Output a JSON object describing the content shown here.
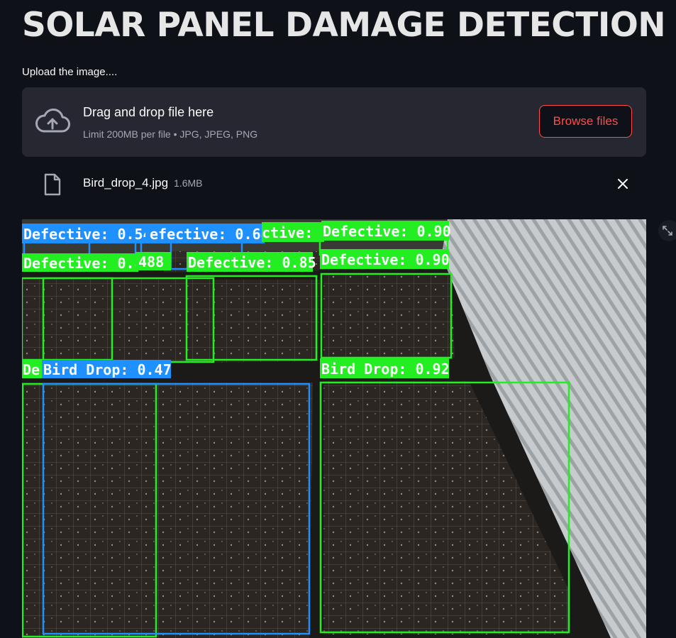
{
  "page": {
    "title": "SOLAR PANEL DAMAGE DETECTION",
    "upload_label": "Upload the image...."
  },
  "uploader": {
    "dropzone_title": "Drag and drop file here",
    "limit_text": "Limit 200MB per file • JPG, JPEG, PNG",
    "browse_label": "Browse files",
    "icon": "cloud-upload-icon"
  },
  "uploaded_file": {
    "name": "Bird_drop_4.jpg",
    "size": "1.6MB",
    "icon": "file-icon",
    "remove_icon": "close-icon"
  },
  "result_image": {
    "labels": {
      "l1": "Defective: 0.54",
      "l2": "efective: 0.68",
      "l3": "ctive: (",
      "l4": "Defective: 0.90",
      "l5": "Defective: 0.84",
      "l6": "488",
      "l7": "Defective: 0.85",
      "l8": "Defective: 0.90",
      "l9": "De",
      "l10": "Bird Drop: 0.47",
      "l11": "Bird Drop: 0.92"
    }
  },
  "colors": {
    "background": "#0e1117",
    "dropzone": "#262730",
    "accent": "#ff4b4b",
    "box_green": "#22ee22",
    "box_blue": "#1e90ff"
  }
}
